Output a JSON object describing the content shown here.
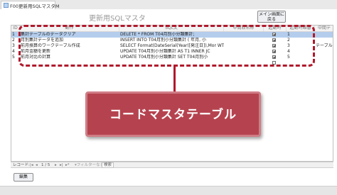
{
  "tab": {
    "label": "F00更新用SQLマスタM"
  },
  "form": {
    "title": "更新用SQLマスタ",
    "menu_button": "メイン画面に\n戻る"
  },
  "grid": {
    "headers": [
      "ID",
      "動作",
      "SQL文",
      "中間取名称",
      "起動時",
      "起動時順番",
      "中間テ"
    ],
    "rows": [
      {
        "id": "1",
        "action": "集計テーブルのデータクリア",
        "sql": "DELETE * FROM T04月別小分類集計;",
        "startup": true,
        "order": "1",
        "extra": "",
        "selected": true
      },
      {
        "id": "2",
        "action": "月別集計データを追加",
        "sql": "INSERT INTO T04月別小分類集計 ( 年月, 小",
        "startup": true,
        "order": "2",
        "extra": "",
        "selected": false
      },
      {
        "id": "3",
        "action": "前月換算のワークテーブル作成",
        "sql": "SELECT Format(DateSerial(Year([発注日]),Mor WT06前月小分類集計",
        "startup": true,
        "order": "3",
        "extra": "テーブル",
        "selected": false
      },
      {
        "id": "4",
        "action": "前月金額を更新",
        "sql": "UPDATE T04月別小分類集計 AS T1 INNER JC",
        "startup": true,
        "order": "4",
        "extra": "",
        "selected": false
      },
      {
        "id": "5",
        "action": "前月対比の計算",
        "sql": "UPDATE T04月別小分類集計 SET T04月別小",
        "startup": true,
        "order": "5",
        "extra": "",
        "selected": false
      }
    ]
  },
  "callout": {
    "text": "コードマスタテーブル"
  },
  "navbar": {
    "record_label": "レコード:",
    "position": "1 / 5",
    "filter": "フィルターなし",
    "search": "検索"
  },
  "edit_button": "編集",
  "colors": {
    "accent": "#b0192c",
    "callout_fill": "#b5434f",
    "selection": "#b4cdec"
  }
}
